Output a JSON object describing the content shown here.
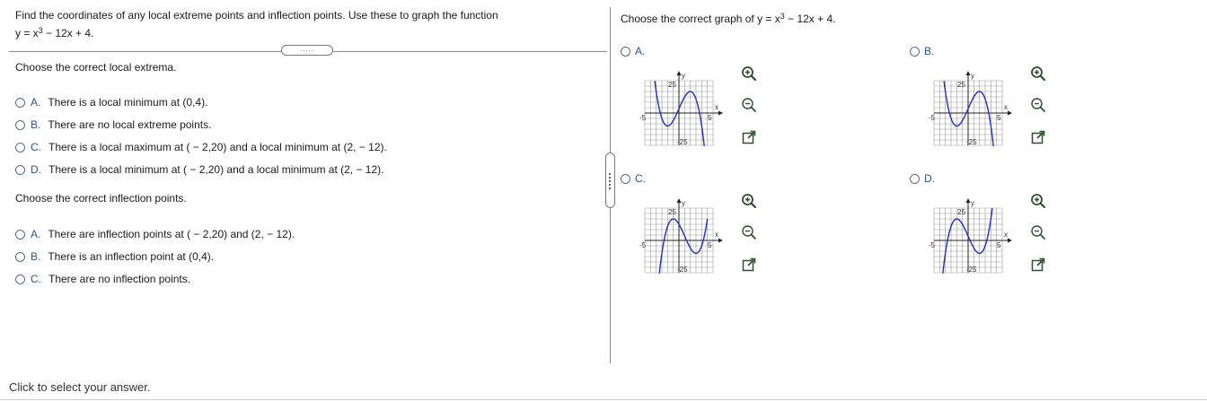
{
  "left": {
    "prompt_line1": "Find the coordinates of any local extreme points and inflection points. Use these to graph the function",
    "prompt_line2_pre": "y = x",
    "prompt_line2_exp": "3",
    "prompt_line2_post": " − 12x + 4.",
    "divider_handle": ".....",
    "extrema_heading": "Choose the correct local extrema.",
    "extrema_options": [
      {
        "label": "A.",
        "text": "There is a local minimum at (0,4)."
      },
      {
        "label": "B.",
        "text": "There are no local extreme points."
      },
      {
        "label": "C.",
        "text": "There is a local maximum at ( − 2,20) and a local minimum at (2, − 12)."
      },
      {
        "label": "D.",
        "text": "There is a local minimum at ( − 2,20) and a local minimum at (2, − 12)."
      }
    ],
    "inflection_heading": "Choose the correct inflection points.",
    "inflection_options": [
      {
        "label": "A.",
        "text": "There are inflection points at ( − 2,20) and (2, − 12)."
      },
      {
        "label": "B.",
        "text": "There is an inflection point at (0,4)."
      },
      {
        "label": "C.",
        "text": "There are no inflection points."
      }
    ],
    "footer": "Click to select your answer."
  },
  "right": {
    "heading_pre": "Choose the correct graph of y = x",
    "heading_exp": "3",
    "heading_post": " − 12x + 4.",
    "graph_options": [
      {
        "label": "A."
      },
      {
        "label": "B."
      },
      {
        "label": "C."
      },
      {
        "label": "D."
      }
    ],
    "axis": {
      "y_label": "y",
      "x_label": "x",
      "y_top": "25",
      "y_bottom": "-25",
      "x_left": "-5",
      "x_right": "5"
    }
  },
  "colors": {
    "accent": "#2a5590",
    "curve": "#1f2fbf",
    "grid": "#9a9a9a"
  },
  "icons": [
    "zoom-in-icon",
    "zoom-out-icon",
    "open-new-window-icon"
  ]
}
